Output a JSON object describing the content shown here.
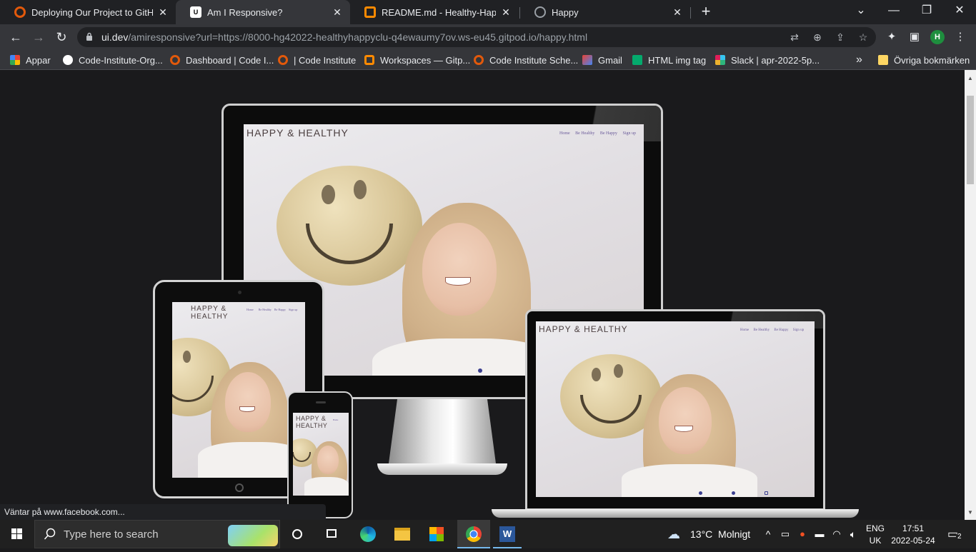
{
  "browser": {
    "tabs": [
      {
        "title": "Deploying Our Project to GitHub",
        "active": false,
        "favicon": "code-institute-icon",
        "color": "#e2590b"
      },
      {
        "title": "Am I Responsive?",
        "active": true,
        "favicon": "ui-dev-icon",
        "color": "#ffffff"
      },
      {
        "title": "README.md - Healthy-Happy-Cl",
        "active": false,
        "favicon": "gitpod-icon",
        "color": "#ff8a00"
      },
      {
        "title": "Happy",
        "active": false,
        "favicon": "globe-icon",
        "color": "#9aa0a6"
      }
    ],
    "new_tab_symbol": "+",
    "url_host": "ui.dev",
    "url_rest": "/amiresponsive?url=https://8000-hg42022-healthyhappyclu-q4ewaumy7ov.ws-eu45.gitpod.io/happy.html",
    "avatar_letter": "H",
    "bookmarks": [
      {
        "label": "Appar",
        "icon": "apps-grid-icon",
        "color": "#e94235"
      },
      {
        "label": "Code-Institute-Org...",
        "icon": "github-icon",
        "color": "#ffffff"
      },
      {
        "label": "Dashboard | Code I...",
        "icon": "code-institute-icon",
        "color": "#e2590b"
      },
      {
        "label": "| Code Institute",
        "icon": "code-institute-icon",
        "color": "#e2590b"
      },
      {
        "label": "Workspaces — Gitp...",
        "icon": "gitpod-icon",
        "color": "#ff8a00"
      },
      {
        "label": "Code Institute Sche...",
        "icon": "code-institute-icon",
        "color": "#e2590b"
      },
      {
        "label": "Gmail",
        "icon": "gmail-icon",
        "color": "#ea4335"
      },
      {
        "label": "HTML img tag",
        "icon": "w3schools-icon",
        "color": "#04aa6d"
      },
      {
        "label": "Slack | apr-2022-5p...",
        "icon": "slack-icon",
        "color": "#e01e5a"
      }
    ],
    "bookmarks_overflow": "»",
    "other_bookmarks": "Övriga bokmärken",
    "status_text": "Väntar på www.facebook.com..."
  },
  "mockup": {
    "site_title": "HAPPY & HEALTHY",
    "site_title_tablet": "HAPPY &\nHEALTHY",
    "nav": [
      "Home",
      "Be Healthy",
      "Be Happy",
      "Sign up"
    ]
  },
  "taskbar": {
    "search_placeholder": "Type here to search",
    "weather": "13°C  Molnigt",
    "language": "ENG",
    "region": "UK",
    "time": "17:51",
    "date": "2022-05-24",
    "notifications": "2"
  }
}
